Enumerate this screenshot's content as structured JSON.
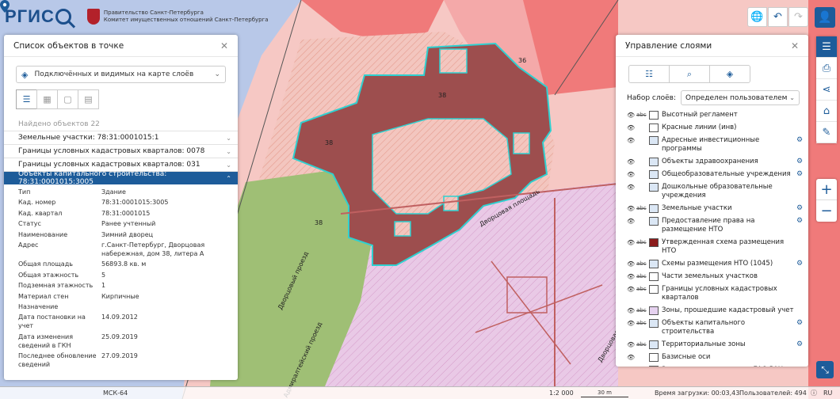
{
  "app": {
    "logo_text": "РГИС",
    "gov_line1": "Правительство Санкт-Петербурга",
    "gov_line2": "Комитет имущественных отношений Санкт-Петербурга"
  },
  "map_labels": {
    "n36": "36",
    "n38a": "38",
    "n38b": "38",
    "n38c": "38",
    "street_dvortsovaya": "Дворцовая площадь",
    "street_dvortsovy_proezd": "Дворцовый проезд",
    "street_admiralteysky": "Адмиралтейский проезд",
    "street_dvortsovaya2": "Дворцовая площадь"
  },
  "left_panel": {
    "title": "Список объектов в точке",
    "select": "Подключённых и видимых на карте слоёв",
    "found": "Найдено объектов 22",
    "groups": [
      {
        "label": "Земельные участки: 78:31:0001015:1"
      },
      {
        "label": "Границы условных кадастровых кварталов: 0078"
      },
      {
        "label": "Границы условных кадастровых кварталов: 031"
      },
      {
        "label": "Объекты капитального строительства: 78:31:0001015:3005"
      }
    ],
    "attributes": [
      {
        "k": "Тип",
        "v": "Здание"
      },
      {
        "k": "Кад. номер",
        "v": "78:31:0001015:3005"
      },
      {
        "k": "Кад. квартал",
        "v": "78:31:0001015"
      },
      {
        "k": "Статус",
        "v": "Ранее учтенный"
      },
      {
        "k": "Наименование",
        "v": "Зимний дворец"
      },
      {
        "k": "Адрес",
        "v": "г.Санкт-Петербург, Дворцовая набережная, дом 38, литера А"
      },
      {
        "k": "Общая площадь",
        "v": "56893.8 кв. м"
      },
      {
        "k": "Общая этажность",
        "v": "5"
      },
      {
        "k": "Подземная этажность",
        "v": "1"
      },
      {
        "k": "Материал стен",
        "v": "Кирпичные"
      },
      {
        "k": "Назначение",
        "v": ""
      },
      {
        "k": "Дата постановки на учет",
        "v": "14.09.2012"
      },
      {
        "k": "Дата изменения сведений в ГКН",
        "v": "25.09.2019"
      },
      {
        "k": "Последнее обновление сведений",
        "v": "27.09.2019"
      }
    ]
  },
  "right_panel": {
    "title": "Управление слоями",
    "set_label": "Набор слоёв:",
    "set_value": "Определен пользователем",
    "layers": [
      {
        "name": "Высотный регламент",
        "abc": "abc",
        "color": "#ffffff",
        "gear": false
      },
      {
        "name": "Красные линии (инв)",
        "abc": "",
        "color": "#ffffff",
        "gear": false
      },
      {
        "name": "Адресные инвестиционные программы",
        "abc": "",
        "color": "#dbe7f5",
        "gear": true
      },
      {
        "name": "Объекты здравоохранения",
        "abc": "",
        "color": "#dbe7f5",
        "gear": true
      },
      {
        "name": "Общеобразовательные учреждения",
        "abc": "",
        "color": "#dbe7f5",
        "gear": true
      },
      {
        "name": "Дошкольные образовательные учреждения",
        "abc": "",
        "color": "#dbe7f5",
        "gear": false
      },
      {
        "name": "Земельные участки",
        "abc": "abc",
        "color": "#dbe7f5",
        "gear": true
      },
      {
        "name": "Предоставление права на размещение НТО",
        "abc": "",
        "color": "#dbe7f5",
        "gear": true
      },
      {
        "name": "Утвержденная схема размещения НТО",
        "abc": "abc",
        "color": "#8c1c1c",
        "gear": false
      },
      {
        "name": "Схемы размещения НТО (1045)",
        "abc": "abc",
        "color": "#dbe7f5",
        "gear": true
      },
      {
        "name": "Части земельных участков",
        "abc": "abc",
        "color": "#ffffff",
        "gear": false
      },
      {
        "name": "Границы условных кадастровых кварталов",
        "abc": "abc",
        "color": "#ffffff",
        "gear": false
      },
      {
        "name": "Зоны, прошедшие кадастровый учет",
        "abc": "abc",
        "color": "#e6d2f0",
        "gear": false
      },
      {
        "name": "Объекты капитального строительства",
        "abc": "abc",
        "color": "#dbe7f5",
        "gear": true
      },
      {
        "name": "Территориальные зоны",
        "abc": "abc",
        "color": "#dbe7f5",
        "gear": true
      },
      {
        "name": "Базисные оси",
        "abc": "",
        "color": "#ffffff",
        "gear": false
      },
      {
        "name": "Защитная парковая зона ГАО РАН",
        "abc": "abc",
        "color": "#f0a0e0",
        "gear": false
      }
    ]
  },
  "status_bar": {
    "crs": "МСК-64",
    "scale": "1:2 000",
    "scalebar": "30 m",
    "load_time": "Время загрузки: 00:03,43",
    "users": "Пользователей: 494",
    "lang": "RU"
  }
}
